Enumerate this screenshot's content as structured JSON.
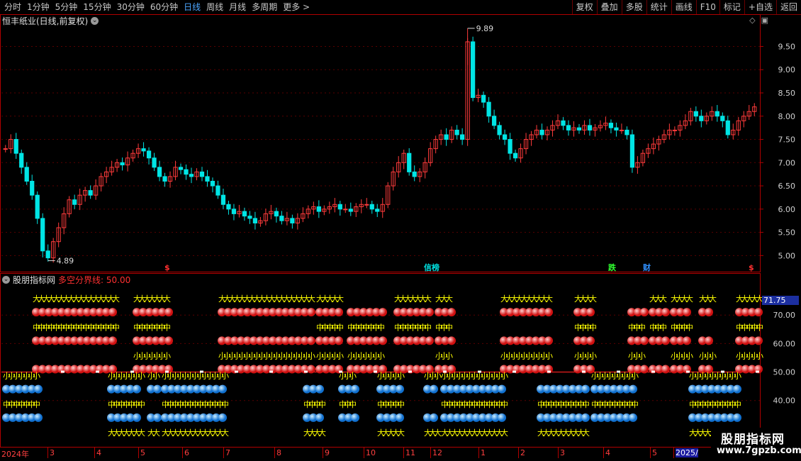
{
  "toolbar": {
    "periods": [
      "分时",
      "1分钟",
      "5分钟",
      "15分钟",
      "30分钟",
      "60分钟",
      "日线",
      "周线",
      "月线",
      "多周期",
      "更多 >"
    ],
    "active_period": "日线",
    "actions": [
      "复权",
      "叠加",
      "多股",
      "统计",
      "画线",
      "F10",
      "标记",
      "+自选",
      "返回"
    ]
  },
  "chart_title": "恒丰纸业(日线,前复权)",
  "sub_indicator": {
    "name": "股朋指标网",
    "param": "多空分界线: 50.00"
  },
  "current_value": "71.75",
  "events": [
    {
      "label": "$",
      "color": "#ff3030"
    },
    {
      "label": "信榜",
      "color": "#00e0e0"
    },
    {
      "label": "跌",
      "color": "#30ff30"
    },
    {
      "label": "财",
      "color": "#3090ff"
    },
    {
      "label": "$",
      "color": "#ff3030"
    }
  ],
  "dates": [
    "2024年",
    "3",
    "4",
    "5",
    "6",
    "7",
    "8",
    "9",
    "10",
    "11",
    "12",
    "1",
    "2",
    "3",
    "4",
    "5",
    "2025/"
  ],
  "watermark": {
    "line1": "股朋指标网",
    "line2": "www.7gpzb.com"
  },
  "colors": {
    "up": "#ff3b3b",
    "down": "#00e5e5",
    "frame": "#b00000",
    "bull": "#ff4040",
    "bear": "#3aa0ff",
    "yellow": "#ffff00"
  },
  "chart_data": {
    "type": "candlestick",
    "price_axis_labels": [
      "9.50",
      "9.00",
      "8.50",
      "8.00",
      "7.50",
      "7.00",
      "6.50",
      "6.00",
      "5.50",
      "5.00"
    ],
    "ylim": [
      4.7,
      9.95
    ],
    "max_label": "9.89",
    "min_label": "4.89",
    "closes": [
      7.3,
      7.5,
      7.2,
      6.9,
      6.6,
      6.3,
      5.8,
      5.1,
      4.95,
      5.3,
      5.6,
      5.9,
      6.2,
      6.1,
      6.3,
      6.4,
      6.3,
      6.5,
      6.7,
      6.8,
      6.9,
      7.0,
      6.95,
      7.1,
      7.2,
      7.3,
      7.25,
      7.1,
      6.9,
      6.7,
      6.6,
      6.7,
      6.9,
      6.85,
      6.75,
      6.7,
      6.8,
      6.7,
      6.6,
      6.5,
      6.3,
      6.1,
      6.0,
      5.9,
      5.95,
      5.85,
      5.8,
      5.7,
      5.75,
      5.9,
      5.95,
      5.85,
      5.75,
      5.8,
      5.7,
      5.8,
      5.9,
      6.0,
      6.05,
      5.95,
      6.0,
      6.05,
      6.1,
      6.0,
      6.0,
      5.95,
      6.05,
      6.1,
      6.1,
      6.0,
      5.95,
      6.1,
      6.5,
      6.8,
      7.0,
      7.2,
      6.8,
      6.7,
      6.8,
      7.0,
      7.3,
      7.5,
      7.6,
      7.5,
      7.7,
      7.6,
      7.5,
      9.6,
      8.4,
      8.45,
      8.3,
      8.0,
      7.8,
      7.6,
      7.5,
      7.2,
      7.1,
      7.3,
      7.5,
      7.6,
      7.7,
      7.6,
      7.7,
      7.8,
      7.9,
      7.8,
      7.7,
      7.75,
      7.7,
      7.8,
      7.7,
      7.75,
      7.8,
      7.85,
      7.75,
      7.7,
      7.7,
      7.6,
      6.9,
      7.0,
      7.2,
      7.3,
      7.4,
      7.5,
      7.6,
      7.7,
      7.7,
      7.8,
      7.9,
      8.1,
      8.0,
      7.9,
      8.0,
      8.1,
      8.0,
      7.9,
      7.6,
      7.7,
      7.9,
      8.0,
      8.1,
      8.2
    ],
    "sub_axis_labels": [
      "70.00",
      "60.00",
      "50.00",
      "40.00"
    ],
    "sub_ylim": [
      34,
      81
    ],
    "divider": 50.0,
    "bull_rows": [
      {
        "level": 76,
        "glyph": "大"
      },
      {
        "level": 71,
        "glyph": "ball"
      },
      {
        "level": 66,
        "glyph": "中"
      },
      {
        "level": 61,
        "glyph": "ball"
      },
      {
        "level": 56,
        "glyph": "小"
      },
      {
        "level": 51,
        "glyph": "ball"
      }
    ],
    "bear_rows": [
      {
        "level": 49,
        "glyph": "小"
      },
      {
        "level": 44,
        "glyph": "ball"
      },
      {
        "level": 39,
        "glyph": "中"
      },
      {
        "level": 34,
        "glyph": "ball"
      },
      {
        "level": 29,
        "glyph": "大"
      }
    ]
  }
}
